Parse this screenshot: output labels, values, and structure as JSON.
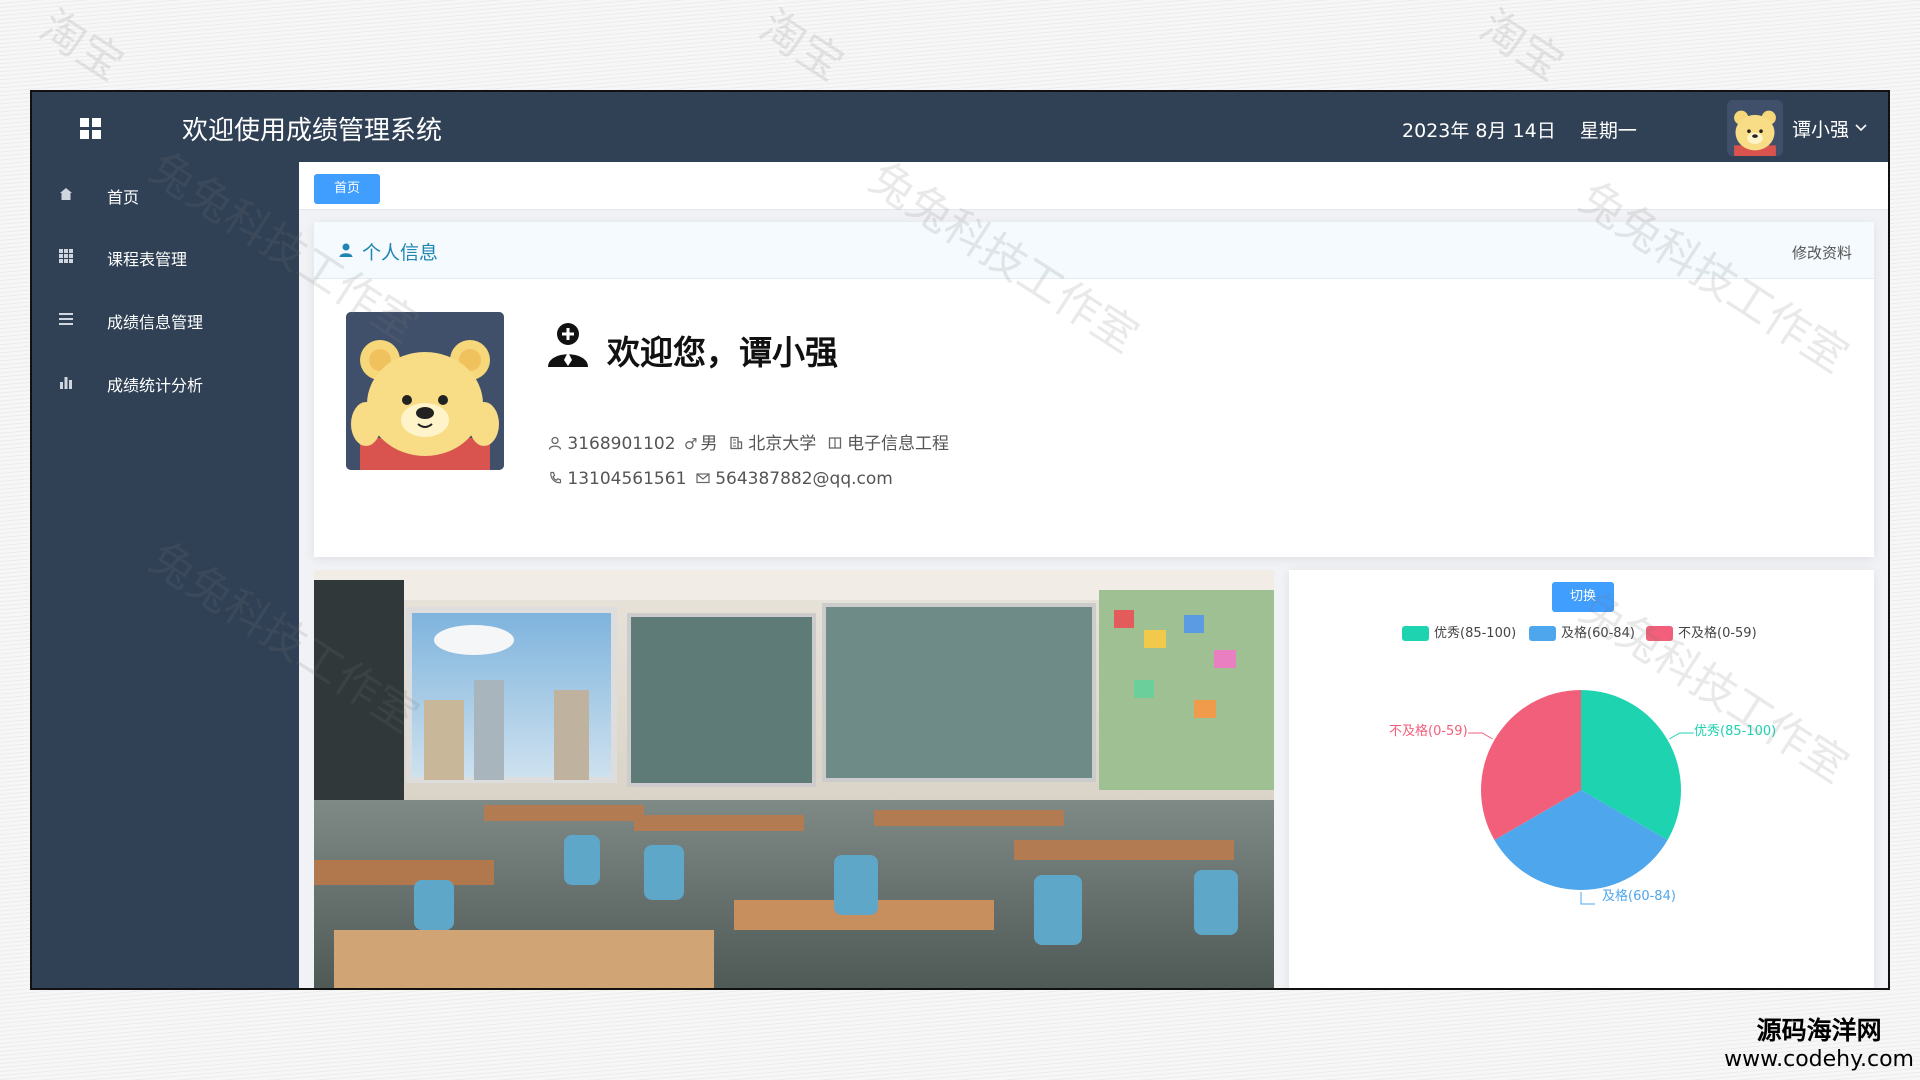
{
  "header": {
    "title": "欢迎使用成绩管理系统",
    "date": "2023年 8月 14日",
    "weekday": "星期一",
    "user_name": "谭小强",
    "menu_icon": "grid-icon",
    "caret_icon": "chevron-down-icon"
  },
  "sidebar": {
    "items": [
      {
        "label": "首页",
        "icon": "home-icon"
      },
      {
        "label": "课程表管理",
        "icon": "grid-icon"
      },
      {
        "label": "成绩信息管理",
        "icon": "list-icon"
      },
      {
        "label": "成绩统计分析",
        "icon": "bar-chart-icon"
      }
    ]
  },
  "tabs": [
    {
      "label": "首页"
    }
  ],
  "profile": {
    "section_title": "个人信息",
    "edit_label": "修改资料",
    "welcome": "欢迎您，谭小强",
    "student_id": "3168901102",
    "gender": "男",
    "school": "北京大学",
    "major": "电子信息工程",
    "phone": "13104561561",
    "email": "564387882@qq.com"
  },
  "chart_panel": {
    "switch_label": "切换"
  },
  "chart_data": {
    "type": "pie",
    "categories": [
      "优秀(85-100)",
      "及格(60-84)",
      "不及格(0-59)"
    ],
    "values": [
      1,
      1,
      1
    ],
    "colors": [
      "#1dd3b0",
      "#4ea6ec",
      "#f25f7a"
    ],
    "legend_position": "top-center"
  },
  "watermark": {
    "lines": [
      "淘宝",
      "兔兔科技工作室"
    ],
    "corner_title": "源码海洋网",
    "corner_url": "www.codehy.com"
  },
  "colors": {
    "sidebar_bg": "#304156",
    "accent": "#409eff",
    "section_title": "#1f85b2"
  }
}
